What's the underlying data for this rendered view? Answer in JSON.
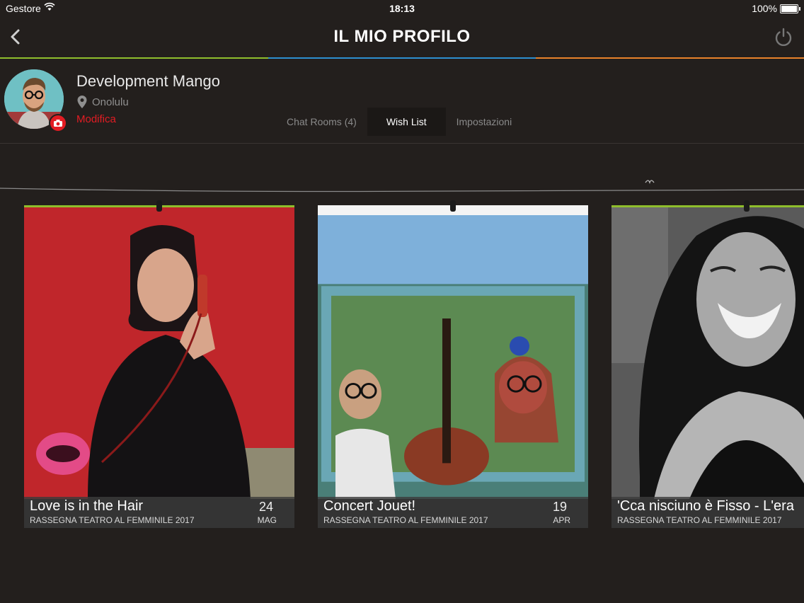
{
  "status": {
    "carrier": "Gestore",
    "time": "18:13",
    "battery": "100%"
  },
  "nav": {
    "title": "IL MIO PROFILO"
  },
  "accent_colors": [
    "#8fbe2c",
    "#2d8fd0",
    "#e8812a"
  ],
  "profile": {
    "name": "Development Mango",
    "location": "Onolulu",
    "edit_label": "Modifica"
  },
  "tabs": [
    {
      "label": "Chat Rooms (4)",
      "active": false
    },
    {
      "label": "Wish List",
      "active": true
    },
    {
      "label": "Impostazioni",
      "active": false
    }
  ],
  "cards": [
    {
      "title": "Love is in the Hair",
      "subtitle": "RASSEGNA TEATRO AL FEMMINILE 2017",
      "day": "24",
      "month": "MAG"
    },
    {
      "title": "Concert Jouet!",
      "subtitle": "RASSEGNA TEATRO AL FEMMINILE 2017",
      "day": "19",
      "month": "APR"
    },
    {
      "title": "'Cca nisciuno è Fisso - L'era",
      "subtitle": "RASSEGNA TEATRO AL FEMMINILE 2017",
      "day": "",
      "month": ""
    }
  ]
}
